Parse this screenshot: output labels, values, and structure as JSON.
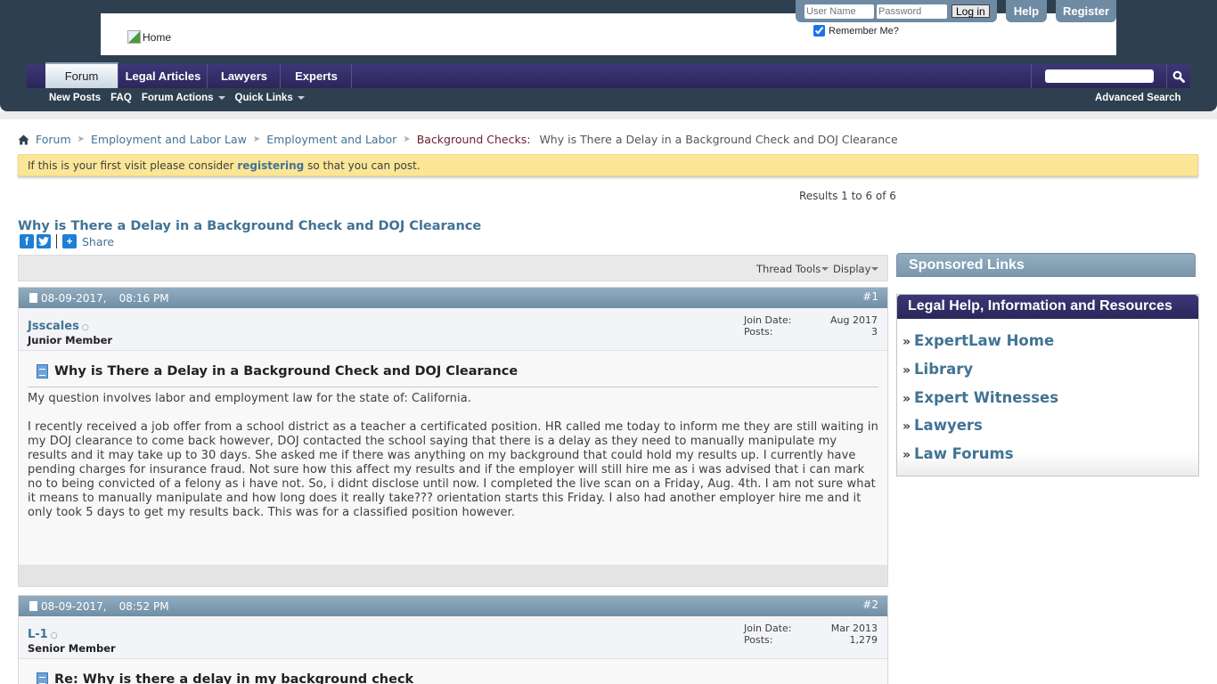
{
  "header": {
    "logo_alt": "Home",
    "login": {
      "username_placeholder": "User Name",
      "password_placeholder": "Password",
      "login_label": "Log in",
      "remember_label": "Remember Me?",
      "remember_checked": true
    },
    "help_label": "Help",
    "register_label": "Register"
  },
  "nav": {
    "tabs": [
      {
        "label": "Forum",
        "active": true
      },
      {
        "label": "Legal Articles",
        "active": false
      },
      {
        "label": "Lawyers",
        "active": false
      },
      {
        "label": "Experts",
        "active": false
      }
    ],
    "search_placeholder": "",
    "subnav": [
      {
        "label": "New Posts",
        "dropdown": false
      },
      {
        "label": "FAQ",
        "dropdown": false
      },
      {
        "label": "Forum Actions",
        "dropdown": true
      },
      {
        "label": "Quick Links",
        "dropdown": true
      }
    ],
    "advanced_search_label": "Advanced Search"
  },
  "breadcrumb": {
    "items": [
      "Forum",
      "Employment and Labor Law",
      "Employment and Labor"
    ],
    "current_forum": "Background Checks:",
    "thread": "Why is There a Delay in a Background Check and DOJ Clearance"
  },
  "notice": {
    "before": "If this is your first visit please consider ",
    "link": "registering",
    "after": " so that you can post."
  },
  "results_text": "Results 1 to 6 of 6",
  "thread": {
    "title": "Why is There a Delay in a Background Check and DOJ Clearance",
    "share_label": "Share",
    "thread_tools_label": "Thread Tools",
    "display_label": "Display"
  },
  "posts": [
    {
      "date": "08-09-2017,",
      "time": "08:16 PM",
      "number": "#1",
      "username": "Jsscales",
      "user_title": "Junior Member",
      "join_date_label": "Join Date:",
      "join_date": "Aug 2017",
      "posts_label": "Posts:",
      "posts_count": "3",
      "title": "Why is There a Delay in a Background Check and DOJ Clearance",
      "body": [
        "My question involves labor and employment law for the state of: California.",
        "I recently received a job offer from a school district as a teacher a certificated position. HR called me today to inform me they are still waiting in my DOJ clearance to come back however, DOJ contacted the school saying that there is a delay as they need to manually manipulate my results and it may take up to 30 days. She asked me if there was anything on my background that could hold my results up. I currently have pending charges for insurance fraud. Not sure how this affect my results and if the employer will still hire me as i was advised that i can mark no to being convicted of a felony as i have not. So, i didnt disclose until now. I completed the live scan on a Friday, Aug. 4th. I am not sure what it means to manually manipulate and how long does it really take??? orientation starts this Friday. I also had another employer hire me and it only took 5 days to get my results back. This was for a classified position however."
      ]
    },
    {
      "date": "08-09-2017,",
      "time": "08:52 PM",
      "number": "#2",
      "username": "L-1",
      "user_title": "Senior Member",
      "join_date_label": "Join Date:",
      "join_date": "Mar 2013",
      "posts_label": "Posts:",
      "posts_count": "1,279",
      "title": "Re: Why is there a delay in my background check"
    }
  ],
  "sidebar": {
    "sponsored_title": "Sponsored Links",
    "legal_title": "Legal Help, Information and Resources",
    "links": [
      "ExpertLaw Home",
      "Library",
      "Expert Witnesses",
      "Lawyers",
      "Law Forums"
    ]
  }
}
